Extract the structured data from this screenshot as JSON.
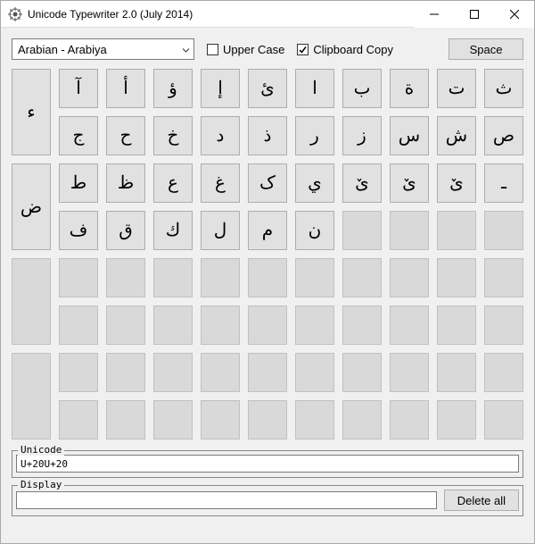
{
  "window": {
    "title": "Unicode Typewriter 2.0 (July 2014)"
  },
  "toolbar": {
    "language_selected": "Arabian        - Arabiya",
    "upper_case_label": "Upper Case",
    "upper_case_checked": false,
    "clipboard_copy_label": "Clipboard Copy",
    "clipboard_copy_checked": true,
    "space_label": "Space"
  },
  "keys": [
    "ء",
    "آ",
    "أ",
    "ؤ",
    "إ",
    "ئ",
    "ا",
    "ب",
    "ة",
    "ت",
    "ث",
    "ج",
    "ح",
    "خ",
    "د",
    "ذ",
    "ر",
    "ز",
    "س",
    "ش",
    "ص",
    "ض",
    "ط",
    "ظ",
    "ع",
    "غ",
    "ک",
    "ي",
    "ێ",
    "ێ",
    "ێ",
    "ـ",
    "ف",
    "ق",
    "ك",
    "ل",
    "م",
    "ن"
  ],
  "grid_rows": 8,
  "grid_cols": 11,
  "first_col_row_span": 2,
  "first_col_populated_rows": 4,
  "unicode_field": {
    "label": "Unicode",
    "value": "U+20U+20"
  },
  "display_field": {
    "label": "Display",
    "value": ""
  },
  "delete_all_label": "Delete all"
}
